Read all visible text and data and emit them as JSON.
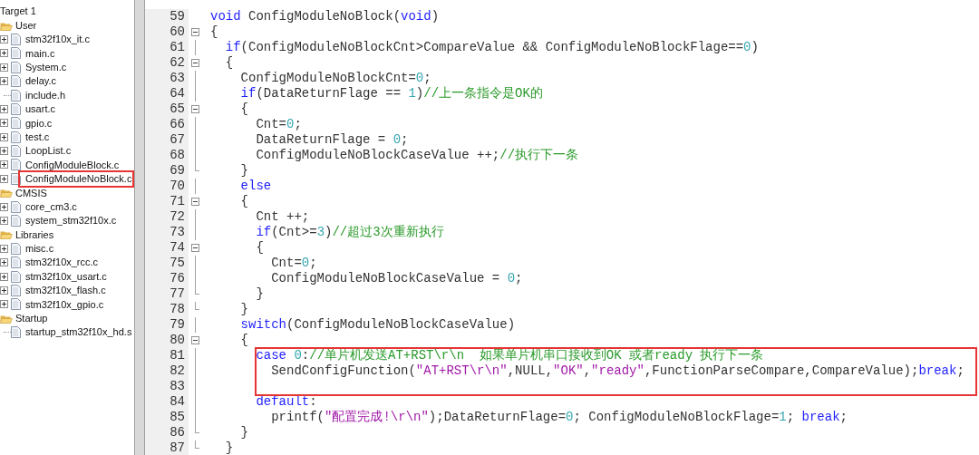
{
  "project_tree": [
    {
      "kind": "target",
      "label": "Target 1",
      "children": [
        {
          "kind": "group",
          "label": "User",
          "expanded": true,
          "children": [
            {
              "kind": "file",
              "label": "stm32f10x_it.c",
              "expandable": true,
              "highlighted": false
            },
            {
              "kind": "file",
              "label": "main.c",
              "expandable": true,
              "highlighted": false
            },
            {
              "kind": "file",
              "label": "System.c",
              "expandable": true,
              "highlighted": false
            },
            {
              "kind": "file",
              "label": "delay.c",
              "expandable": true,
              "highlighted": false
            },
            {
              "kind": "file",
              "label": "include.h",
              "expandable": false,
              "highlighted": false
            },
            {
              "kind": "file",
              "label": "usart.c",
              "expandable": true,
              "highlighted": false
            },
            {
              "kind": "file",
              "label": "gpio.c",
              "expandable": true,
              "highlighted": false
            },
            {
              "kind": "file",
              "label": "test.c",
              "expandable": true,
              "highlighted": false
            },
            {
              "kind": "file",
              "label": "LoopList.c",
              "expandable": true,
              "highlighted": false
            },
            {
              "kind": "file",
              "label": "ConfigModuleBlock.c",
              "expandable": true,
              "highlighted": false
            },
            {
              "kind": "file",
              "label": "ConfigModuleNoBlock.c",
              "expandable": true,
              "highlighted": true
            }
          ]
        },
        {
          "kind": "group",
          "label": "CMSIS",
          "expanded": true,
          "children": [
            {
              "kind": "file",
              "label": "core_cm3.c",
              "expandable": true,
              "highlighted": false
            },
            {
              "kind": "file",
              "label": "system_stm32f10x.c",
              "expandable": true,
              "highlighted": false
            }
          ]
        },
        {
          "kind": "group",
          "label": "Libraries",
          "expanded": true,
          "children": [
            {
              "kind": "file",
              "label": "misc.c",
              "expandable": true,
              "highlighted": false
            },
            {
              "kind": "file",
              "label": "stm32f10x_rcc.c",
              "expandable": true,
              "highlighted": false
            },
            {
              "kind": "file",
              "label": "stm32f10x_usart.c",
              "expandable": true,
              "highlighted": false
            },
            {
              "kind": "file",
              "label": "stm32f10x_flash.c",
              "expandable": true,
              "highlighted": false
            },
            {
              "kind": "file",
              "label": "stm32f10x_gpio.c",
              "expandable": true,
              "highlighted": false
            }
          ]
        },
        {
          "kind": "group",
          "label": "Startup",
          "expanded": true,
          "children": [
            {
              "kind": "file",
              "label": "startup_stm32f10x_hd.s",
              "expandable": false,
              "highlighted": false
            }
          ]
        }
      ]
    }
  ],
  "editor": {
    "lines": [
      {
        "number": "59",
        "kind": "plain",
        "highlighted": false,
        "code": [
          {
            "kind": "keyword",
            "text": "void"
          },
          {
            "kind": "plain",
            "text": " ConfigModuleNoBlock("
          },
          {
            "kind": "keyword",
            "text": "void"
          },
          {
            "kind": "plain",
            "text": ")"
          }
        ]
      },
      {
        "number": "60",
        "kind": "fold_start",
        "highlighted": false,
        "code": [
          {
            "kind": "plain",
            "text": "{"
          }
        ]
      },
      {
        "number": "61",
        "kind": "fold_body",
        "highlighted": false,
        "code": [
          {
            "kind": "keyword",
            "text": "  if"
          },
          {
            "kind": "plain",
            "text": "(ConfigModuleNoBlockCnt>CompareValue && ConfigModuleNoBlockFlage=="
          },
          {
            "kind": "number",
            "text": "0"
          },
          {
            "kind": "plain",
            "text": ")"
          }
        ]
      },
      {
        "number": "62",
        "kind": "fold_start",
        "highlighted": false,
        "code": [
          {
            "kind": "plain",
            "text": "  {"
          }
        ]
      },
      {
        "number": "63",
        "kind": "fold_body",
        "highlighted": false,
        "code": [
          {
            "kind": "plain",
            "text": "    ConfigModuleNoBlockCnt="
          },
          {
            "kind": "number",
            "text": "0"
          },
          {
            "kind": "plain",
            "text": ";"
          }
        ]
      },
      {
        "number": "64",
        "kind": "fold_body",
        "highlighted": false,
        "code": [
          {
            "kind": "keyword",
            "text": "    if"
          },
          {
            "kind": "plain",
            "text": "(DataReturnFlage == "
          },
          {
            "kind": "number",
            "text": "1"
          },
          {
            "kind": "plain",
            "text": ")"
          },
          {
            "kind": "comment",
            "text": "//上一条指令是OK的"
          }
        ]
      },
      {
        "number": "65",
        "kind": "fold_start",
        "highlighted": false,
        "code": [
          {
            "kind": "plain",
            "text": "    {"
          }
        ]
      },
      {
        "number": "66",
        "kind": "fold_body",
        "highlighted": false,
        "code": [
          {
            "kind": "plain",
            "text": "      Cnt="
          },
          {
            "kind": "number",
            "text": "0"
          },
          {
            "kind": "plain",
            "text": ";"
          }
        ]
      },
      {
        "number": "67",
        "kind": "fold_body",
        "highlighted": false,
        "code": [
          {
            "kind": "plain",
            "text": "      DataReturnFlage = "
          },
          {
            "kind": "number",
            "text": "0"
          },
          {
            "kind": "plain",
            "text": ";"
          }
        ]
      },
      {
        "number": "68",
        "kind": "fold_body",
        "highlighted": false,
        "code": [
          {
            "kind": "plain",
            "text": "      ConfigModuleNoBlockCaseValue ++;"
          },
          {
            "kind": "comment",
            "text": "//执行下一条"
          }
        ]
      },
      {
        "number": "69",
        "kind": "fold_end",
        "highlighted": false,
        "code": [
          {
            "kind": "plain",
            "text": "    }"
          }
        ]
      },
      {
        "number": "70",
        "kind": "fold_body",
        "highlighted": false,
        "code": [
          {
            "kind": "keyword",
            "text": "    else"
          }
        ]
      },
      {
        "number": "71",
        "kind": "fold_start",
        "highlighted": false,
        "code": [
          {
            "kind": "plain",
            "text": "    {"
          }
        ]
      },
      {
        "number": "72",
        "kind": "fold_body",
        "highlighted": false,
        "code": [
          {
            "kind": "plain",
            "text": "      Cnt ++;"
          }
        ]
      },
      {
        "number": "73",
        "kind": "fold_body",
        "highlighted": false,
        "code": [
          {
            "kind": "keyword",
            "text": "      if"
          },
          {
            "kind": "plain",
            "text": "(Cnt>="
          },
          {
            "kind": "number",
            "text": "3"
          },
          {
            "kind": "plain",
            "text": ")"
          },
          {
            "kind": "comment",
            "text": "//超过3次重新执行"
          }
        ]
      },
      {
        "number": "74",
        "kind": "fold_start",
        "highlighted": false,
        "code": [
          {
            "kind": "plain",
            "text": "      {"
          }
        ]
      },
      {
        "number": "75",
        "kind": "fold_body",
        "highlighted": false,
        "code": [
          {
            "kind": "plain",
            "text": "        Cnt="
          },
          {
            "kind": "number",
            "text": "0"
          },
          {
            "kind": "plain",
            "text": ";"
          }
        ]
      },
      {
        "number": "76",
        "kind": "fold_body",
        "highlighted": false,
        "code": [
          {
            "kind": "plain",
            "text": "        ConfigModuleNoBlockCaseValue = "
          },
          {
            "kind": "number",
            "text": "0"
          },
          {
            "kind": "plain",
            "text": ";"
          }
        ]
      },
      {
        "number": "77",
        "kind": "fold_end",
        "highlighted": false,
        "code": [
          {
            "kind": "plain",
            "text": "      }"
          }
        ]
      },
      {
        "number": "78",
        "kind": "fold_end",
        "highlighted": false,
        "code": [
          {
            "kind": "plain",
            "text": "    }"
          }
        ]
      },
      {
        "number": "79",
        "kind": "fold_body",
        "highlighted": false,
        "code": [
          {
            "kind": "keyword",
            "text": "    switch"
          },
          {
            "kind": "plain",
            "text": "(ConfigModuleNoBlockCaseValue)"
          }
        ]
      },
      {
        "number": "80",
        "kind": "fold_start",
        "highlighted": false,
        "code": [
          {
            "kind": "plain",
            "text": "    {"
          }
        ]
      },
      {
        "number": "81",
        "kind": "fold_body",
        "highlighted": true,
        "code": [
          {
            "kind": "keyword",
            "text": "      case "
          },
          {
            "kind": "number",
            "text": "0"
          },
          {
            "kind": "plain",
            "text": ":"
          },
          {
            "kind": "comment",
            "text": "//单片机发送AT+RST\\r\\n  如果单片机串口接收到OK 或者ready 执行下一条"
          }
        ]
      },
      {
        "number": "82",
        "kind": "fold_body",
        "highlighted": true,
        "code": [
          {
            "kind": "plain",
            "text": "        SendConfigFunction("
          },
          {
            "kind": "string",
            "text": "\"AT+RST\\r\\n\""
          },
          {
            "kind": "plain",
            "text": ",NULL,"
          },
          {
            "kind": "string",
            "text": "\"OK\""
          },
          {
            "kind": "plain",
            "text": ","
          },
          {
            "kind": "string",
            "text": "\"ready\""
          },
          {
            "kind": "plain",
            "text": ",FunctionParseCompare,CompareValue);"
          },
          {
            "kind": "keyword",
            "text": "break"
          },
          {
            "kind": "plain",
            "text": ";"
          }
        ]
      },
      {
        "number": "83",
        "kind": "fold_body",
        "highlighted": true
      },
      {
        "number": "84",
        "kind": "fold_body",
        "highlighted": false,
        "code": [
          {
            "kind": "keyword",
            "text": "      default"
          },
          {
            "kind": "plain",
            "text": ":"
          }
        ]
      },
      {
        "number": "85",
        "kind": "fold_body",
        "highlighted": false,
        "code": [
          {
            "kind": "plain",
            "text": "        printf("
          },
          {
            "kind": "string",
            "text": "\"配置完成!\\r\\n\""
          },
          {
            "kind": "plain",
            "text": ");DataReturnFlage="
          },
          {
            "kind": "number",
            "text": "0"
          },
          {
            "kind": "plain",
            "text": "; ConfigModuleNoBlockFlage="
          },
          {
            "kind": "number",
            "text": "1"
          },
          {
            "kind": "plain",
            "text": "; "
          },
          {
            "kind": "keyword",
            "text": "break"
          },
          {
            "kind": "plain",
            "text": ";"
          }
        ]
      },
      {
        "number": "86",
        "kind": "fold_end",
        "highlighted": false,
        "code": [
          {
            "kind": "plain",
            "text": "    }"
          }
        ]
      },
      {
        "number": "87",
        "kind": "fold_end",
        "highlighted": false,
        "code": [
          {
            "kind": "plain",
            "text": "  }"
          }
        ]
      }
    ]
  }
}
